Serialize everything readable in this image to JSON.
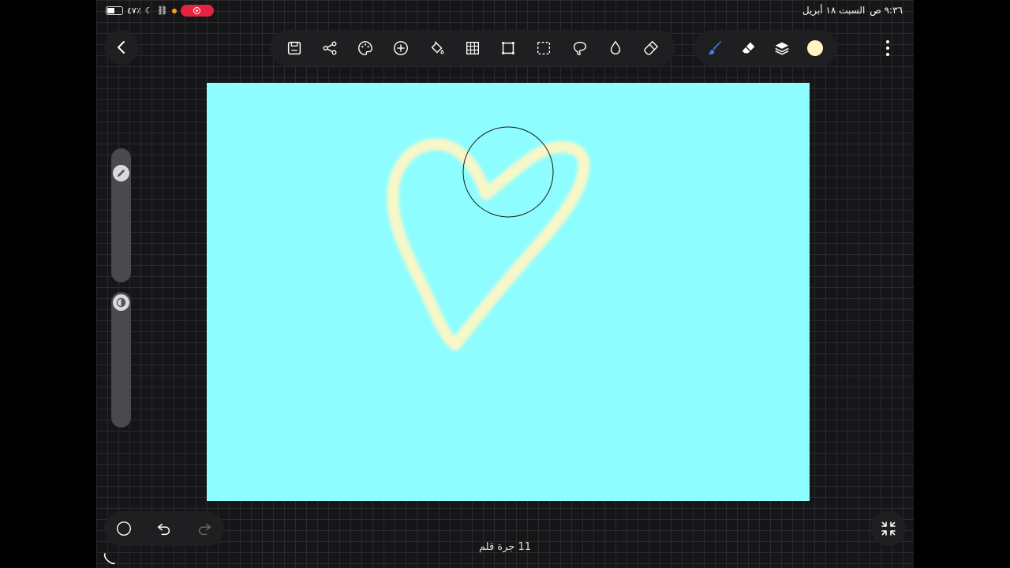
{
  "status_bar": {
    "time": "٩:٣٦ ص",
    "date": "السبت ١٨ أبريل",
    "battery": "٤٧٪"
  },
  "toolbar": {
    "main_tools": [
      "save-icon",
      "share-icon",
      "palette-icon",
      "add-icon",
      "fill-bucket-icon",
      "grid-icon",
      "crop-rectangle-icon",
      "selection-icon",
      "lasso-icon",
      "water-drop-icon",
      "smudge-icon"
    ],
    "right_tools": [
      "brush-icon",
      "eraser-icon",
      "layers-icon",
      "color-swatch"
    ],
    "current_color": "#fff7c2",
    "accent_color": "#3d7de8"
  },
  "canvas": {
    "background_color": "#8efdff",
    "stroke_color": "#fdf7c6"
  },
  "footer": {
    "stroke_count": "11 جرة قلم"
  }
}
